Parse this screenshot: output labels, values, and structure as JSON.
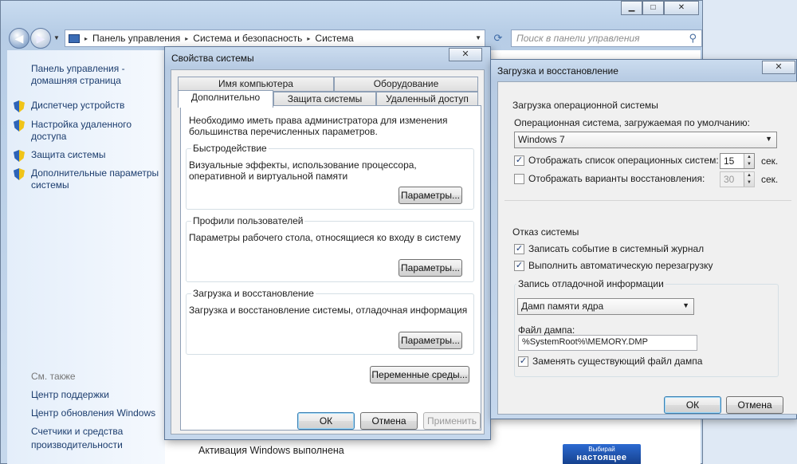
{
  "breadcrumb": [
    "Панель управления",
    "Система и безопасность",
    "Система"
  ],
  "search_placeholder": "Поиск в панели управления",
  "sidebar": {
    "home": "Панель управления - домашняя страница",
    "items": [
      "Диспетчер устройств",
      "Настройка удаленного доступа",
      "Защита системы",
      "Дополнительные параметры системы"
    ],
    "see_also": "См. также",
    "links": [
      "Центр поддержки",
      "Центр обновления Windows",
      "Счетчики и средства производительности"
    ]
  },
  "main": {
    "activation": "Активация Windows выполнена",
    "promo_small": "Выбирай",
    "promo_big": "настоящее"
  },
  "sysprop": {
    "title": "Свойства системы",
    "close": "✕",
    "tabs_top": [
      "Имя компьютера",
      "Оборудование"
    ],
    "tabs_bottom": [
      "Дополнительно",
      "Защита системы",
      "Удаленный доступ"
    ],
    "intro": "Необходимо иметь права администратора для изменения большинства перечисленных параметров.",
    "groups": [
      {
        "label": "Быстродействие",
        "text": "Визуальные эффекты, использование процессора, оперативной и виртуальной памяти",
        "button": "Параметры..."
      },
      {
        "label": "Профили пользователей",
        "text": "Параметры рабочего стола, относящиеся ко входу в систему",
        "button": "Параметры..."
      },
      {
        "label": "Загрузка и восстановление",
        "text": "Загрузка и восстановление системы, отладочная информация",
        "button": "Параметры..."
      }
    ],
    "env_button": "Переменные среды...",
    "ok": "ОК",
    "cancel": "Отмена",
    "apply": "Применить"
  },
  "boot": {
    "title": "Загрузка и восстановление",
    "close": "✕",
    "startup_header": "Загрузка операционной системы",
    "default_os_label": "Операционная система, загружаемая по умолчанию:",
    "default_os_value": "Windows 7",
    "show_os_list_label": "Отображать список операционных систем:",
    "show_os_list_checked": true,
    "os_list_seconds": "15",
    "show_recovery_label": "Отображать варианты восстановления:",
    "show_recovery_checked": false,
    "recovery_seconds": "30",
    "seconds_unit": "сек.",
    "failure_header": "Отказ системы",
    "write_event_label": "Записать событие в системный журнал",
    "write_event_checked": true,
    "auto_restart_label": "Выполнить автоматическую перезагрузку",
    "auto_restart_checked": true,
    "debug_header": "Запись отладочной информации",
    "dump_type_value": "Дамп памяти ядра",
    "dump_file_label": "Файл дампа:",
    "dump_file_value": "%SystemRoot%\\MEMORY.DMP",
    "overwrite_label": "Заменять существующий файл дампа",
    "overwrite_checked": true,
    "ok": "ОК",
    "cancel": "Отмена"
  }
}
